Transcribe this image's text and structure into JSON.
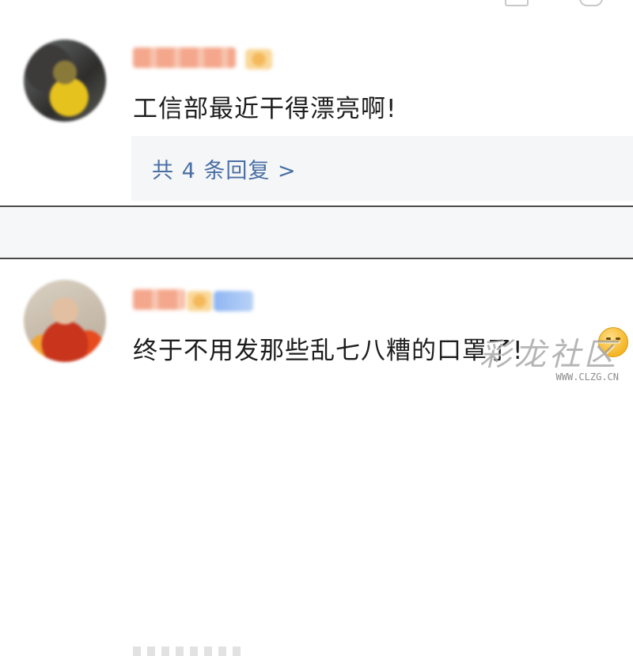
{
  "top_bar": {
    "icons": [
      "share-icon",
      "like-icon"
    ]
  },
  "comments": [
    {
      "avatar": "user-avatar",
      "text": "工信部最近干得漂亮啊!",
      "replies_label": "共 4 条回复 >"
    },
    {
      "avatar": "user-avatar",
      "text": "终于不用发那些乱七八糟的口罩了!"
    }
  ],
  "watermark": {
    "text": "彩龙社区",
    "url": "WWW.CLZG.CN"
  },
  "colors": {
    "link": "#4a6fa3",
    "username_blurred": "#f4a78c",
    "reply_bg": "#f5f6f8"
  }
}
